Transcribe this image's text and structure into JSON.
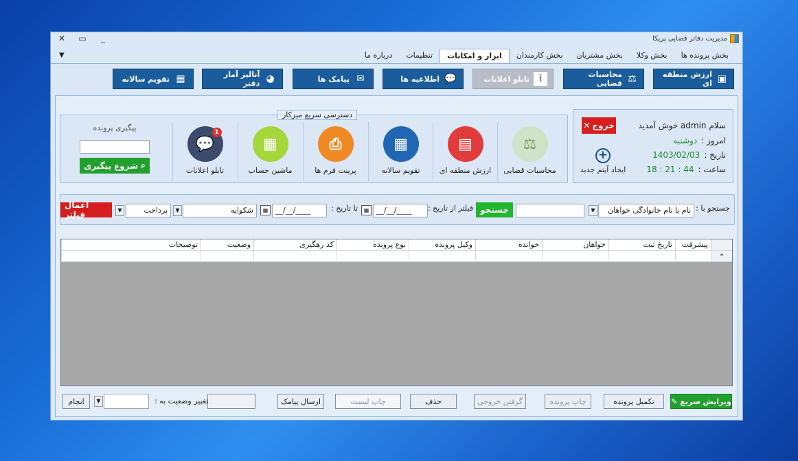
{
  "window": {
    "title": "مدیریت دفاتر قضایی پریکا",
    "buttons": {
      "close": "✕",
      "maximize": "▭",
      "minimize": "_"
    }
  },
  "tabs": [
    {
      "label": "بخش پرونده ها"
    },
    {
      "label": "بخش وکلا"
    },
    {
      "label": "بخش مشتریان"
    },
    {
      "label": "بخش کارمندان"
    },
    {
      "label": "ابزار و امکانات",
      "active": true
    },
    {
      "label": "تنظیمات"
    },
    {
      "label": "درباره ما"
    }
  ],
  "ribbon": {
    "zone_value": "ارزش منطقه ای",
    "judicial_calc": "محاسبات قضایی",
    "notice_board": "تابلو اعلانات",
    "announcements": "اطلاعیه ها",
    "sms": "پیامک ها",
    "stats": "آنالیز آمار دفتر",
    "calendar": "تقویم سالانه"
  },
  "welcome": {
    "hello": "سلام  admin  خوش آمدید",
    "exit_label": "خروج",
    "today_label": "امروز :",
    "today_value": "دوشنبه",
    "date_label": "تاریخ :",
    "date_value": "1403/02/03",
    "time_label": "ساعت :",
    "time_value": "18 : 21 : 44",
    "new_item": "ایجاد آیتم جدید"
  },
  "quick_access": {
    "legend": "دسترسی سریع میزکار",
    "items": [
      {
        "label": "محاسبات قضایی",
        "color": "#cfe3c7"
      },
      {
        "label": "ارزش منطقه ای",
        "color": "#e23b3b"
      },
      {
        "label": "تقویم سالانه",
        "color": "#2166b3"
      },
      {
        "label": "پرینت فرم ها",
        "color": "#f08a24"
      },
      {
        "label": "ماشین حساب",
        "color": "#a5d63a"
      },
      {
        "label": "تابلو اعلانات",
        "color": "#3c4a6b",
        "badge": "1"
      }
    ],
    "follow_title": "پیگیری پرونده",
    "follow_button": "شروع پیگیری"
  },
  "search": {
    "search_by_label": "جستجو با :",
    "search_by_value": "نام یا نام خانوادگی خواهان",
    "search_button": "جستجو",
    "filter_from_label": "فیلتر از تاریخ :",
    "date_placeholder": "__/__/____",
    "to_label": "تا تاریخ :",
    "type_value": "شکوایه",
    "payment_value": "برداخت",
    "apply_filter": "اعمال فیلتر"
  },
  "grid": {
    "columns": [
      "پیشرفت",
      "تاریخ ثبت",
      "خواهان",
      "خوانده",
      "وکیل پرونده",
      "نوع پرونده",
      "کد رهگیری",
      "وضعیت",
      "توضیحات"
    ],
    "row_marker": "*"
  },
  "bottom": {
    "quick_edit": "ویرایش سریع",
    "complete_case": "تکمیل پرونده",
    "print_case": "چاپ پرونده",
    "export": "گرفتن خروجی",
    "delete": "حذف",
    "print_list": "چاپ لیست",
    "send_sms": "ارسال پیامک",
    "change_status": "تغییر وضعیت به :",
    "do": "انجام"
  }
}
